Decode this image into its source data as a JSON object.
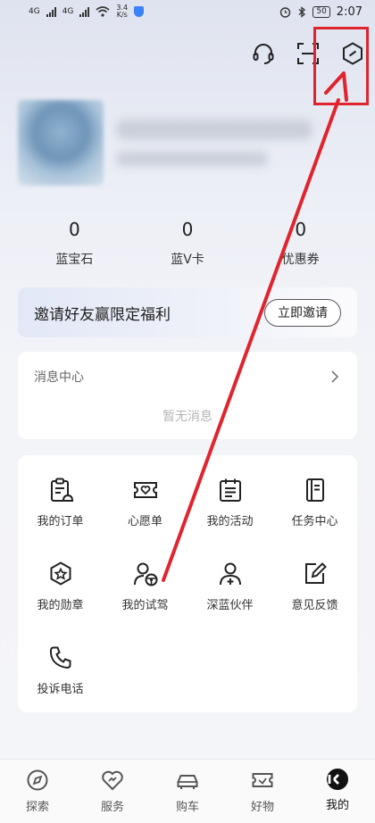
{
  "status_bar": {
    "network_a": "4G",
    "network_b": "4G",
    "speed_value": "3.4",
    "speed_unit": "K/s",
    "battery": "50",
    "time": "2:07"
  },
  "header": {
    "icons": [
      "headset-icon",
      "scan-icon",
      "settings-hexagon-icon"
    ]
  },
  "stats": [
    {
      "value": "0",
      "label": "蓝宝石"
    },
    {
      "value": "0",
      "label": "蓝V卡"
    },
    {
      "value": "0",
      "label": "优惠券"
    }
  ],
  "invite": {
    "title": "邀请好友赢限定福利",
    "button": "立即邀请"
  },
  "messages": {
    "title": "消息中心",
    "empty": "暂无消息"
  },
  "services": [
    {
      "label": "我的订单",
      "icon": "order-icon"
    },
    {
      "label": "心愿单",
      "icon": "wishlist-icon"
    },
    {
      "label": "我的活动",
      "icon": "calendar-icon"
    },
    {
      "label": "任务中心",
      "icon": "task-book-icon"
    },
    {
      "label": "我的勋章",
      "icon": "medal-icon"
    },
    {
      "label": "我的试驾",
      "icon": "test-drive-icon"
    },
    {
      "label": "深蓝伙伴",
      "icon": "partner-icon"
    },
    {
      "label": "意见反馈",
      "icon": "feedback-icon"
    },
    {
      "label": "投诉电话",
      "icon": "phone-icon"
    }
  ],
  "bottom_nav": [
    {
      "label": "探索",
      "icon": "explore-icon"
    },
    {
      "label": "服务",
      "icon": "service-heart-icon"
    },
    {
      "label": "购车",
      "icon": "car-icon"
    },
    {
      "label": "好物",
      "icon": "goods-ticket-icon"
    },
    {
      "label": "我的",
      "icon": "mine-icon",
      "active": true
    }
  ],
  "colors": {
    "annotation_red": "#e0242e",
    "accent_dark": "#111111"
  }
}
